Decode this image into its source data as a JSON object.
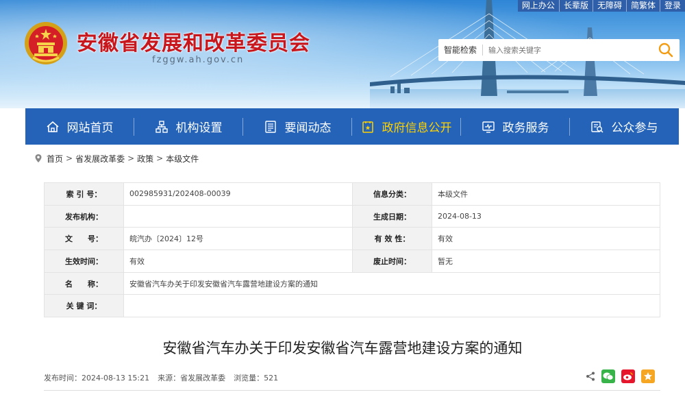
{
  "top_links": [
    "网上办公",
    "长辈版",
    "无障碍",
    "简繁体",
    "登录"
  ],
  "site": {
    "title": "安徽省发展和改革委员会",
    "domain": "fzggw.ah.gov.cn"
  },
  "search": {
    "label": "智能检索",
    "placeholder": "输入搜索关键字"
  },
  "nav": [
    {
      "label": "网站首页",
      "icon": "home-icon"
    },
    {
      "label": "机构设置",
      "icon": "org-chart-icon"
    },
    {
      "label": "要闻动态",
      "icon": "news-icon"
    },
    {
      "label": "政府信息公开",
      "icon": "gov-info-icon",
      "active": true
    },
    {
      "label": "政务服务",
      "icon": "service-icon"
    },
    {
      "label": "公众参与",
      "icon": "participation-icon"
    }
  ],
  "breadcrumb": [
    "首页",
    "省发展改革委",
    "政策",
    "本级文件"
  ],
  "info": {
    "index_label": "索 引 号：",
    "index_value": "002985931/202408-00039",
    "category_label": "信息分类：",
    "category_value": "本级文件",
    "issuer_label": "发布机构：",
    "issuer_value": "",
    "date_label": "生成日期：",
    "date_value": "2024-08-13",
    "docno_label": "文　　号：",
    "docno_value": "皖汽办〔2024〕12号",
    "validity_label": "有 效 性：",
    "validity_value": "有效",
    "effective_label": "生效时间：",
    "effective_value": "有效",
    "expire_label": "废止时间：",
    "expire_value": "暂无",
    "name_label": "名　　称：",
    "name_value": "安徽省汽车办关于印发安徽省汽车露营地建设方案的通知",
    "keywords_label": "关 键 词：",
    "keywords_value": ""
  },
  "article": {
    "title": "安徽省汽车办关于印发安徽省汽车露营地建设方案的通知",
    "publish_time": "发布时间：2024-08-13 15:21",
    "source": "来源：省发展改革委",
    "views": "浏览量：521"
  },
  "colors": {
    "brand_red": "#c8161d",
    "nav_blue": "#2463b8",
    "nav_active": "#ffd200"
  }
}
